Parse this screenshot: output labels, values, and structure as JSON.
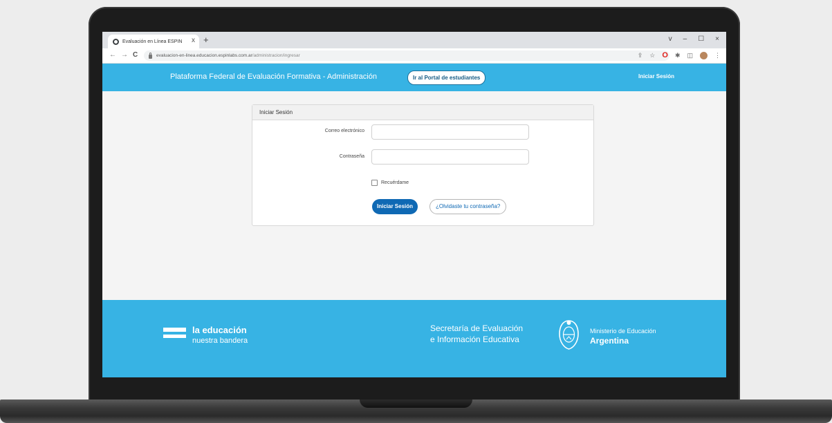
{
  "browser": {
    "tab_title": "Evaluación en Línea ESPIN",
    "tab_close": "x",
    "new_tab": "+",
    "window_controls": [
      "v",
      "–",
      "☐",
      "×"
    ],
    "nav": {
      "back": "←",
      "forward": "→",
      "reload": "C"
    },
    "url_host": "evaluacion-en-linea.educacion.espinlabs.com.ar",
    "url_path": "/administracion/ingresar"
  },
  "header": {
    "title": "Plataforma Federal de Evaluación Formativa - Administración",
    "portal_button": "Ir al Portal de estudiantes",
    "login_link": "Iniciar Sesión"
  },
  "login": {
    "card_title": "Iniciar Sesión",
    "email_label": "Correo electrónico",
    "email_value": "",
    "password_label": "Contraseña",
    "password_value": "",
    "remember_label": "Recuérdame",
    "submit_button": "Iniciar Sesión",
    "forgot_button": "¿Olvidaste tu contraseña?"
  },
  "footer": {
    "brand_line1": "la educación",
    "brand_line2": "nuestra bandera",
    "secretaria_line1": "Secretaría de Evaluación",
    "secretaria_line2": "e Información Educativa",
    "ministerio_line1": "Ministerio de Educación",
    "ministerio_line2": "Argentina"
  },
  "colors": {
    "header_blue": "#37b3e4",
    "primary_button": "#0f69b4",
    "page_background": "#f4f4f4"
  }
}
